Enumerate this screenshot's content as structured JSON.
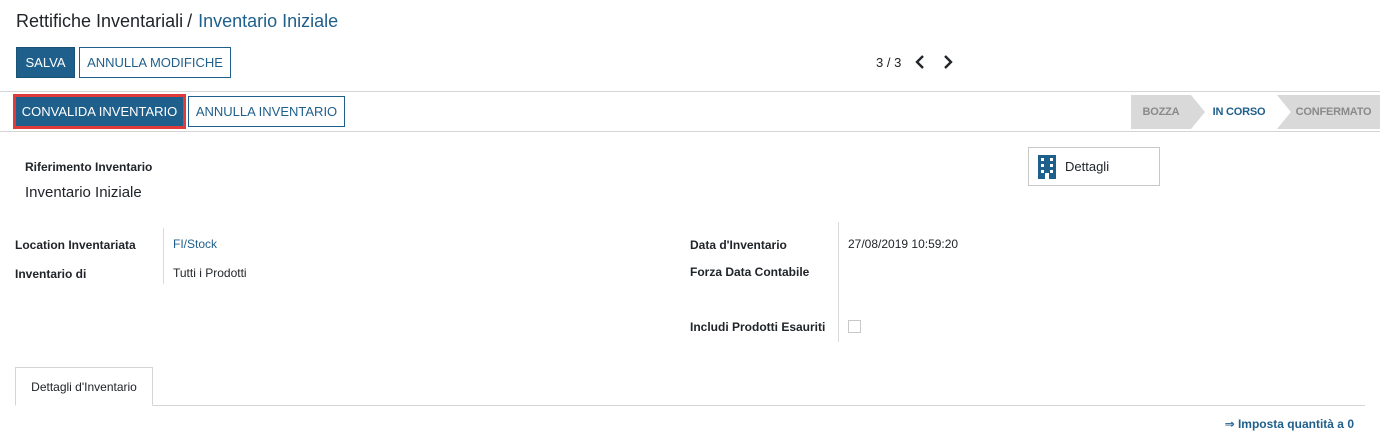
{
  "breadcrumb": {
    "parent": "Rettifiche Inventariali",
    "separator": "/",
    "current": "Inventario Iniziale"
  },
  "toolbar": {
    "save_label": "SALVA",
    "discard_label": "ANNULLA MODIFICHE"
  },
  "pager": {
    "value": "3 / 3"
  },
  "statusbar": {
    "validate_label": "CONVALIDA INVENTARIO",
    "cancel_label": "ANNULLA INVENTARIO",
    "stages": [
      "BOZZA",
      "IN CORSO",
      "CONFERMATO"
    ],
    "current_stage": "IN CORSO"
  },
  "form": {
    "reference_label": "Riferimento Inventario",
    "reference_value": "Inventario Iniziale",
    "details_button": "Dettagli",
    "location_label": "Location Inventariata",
    "location_value": "FI/Stock",
    "inventory_of_label": "Inventario di",
    "inventory_of_value": "Tutti i Prodotti",
    "date_label": "Data d'Inventario",
    "date_value": "27/08/2019 10:59:20",
    "force_date_label": "Forza Data Contabile",
    "force_date_value": "",
    "include_exhausted_label": "Includi Prodotti Esauriti",
    "include_exhausted_checked": false
  },
  "tabs": {
    "details_tab": "Dettagli d'Inventario"
  },
  "actions": {
    "set_zero": "⇒ Imposta quantità a 0"
  },
  "colors": {
    "primary": "#1f5f8b",
    "highlight": "#e03b3b",
    "stage_inactive": "#d9d9d9"
  }
}
